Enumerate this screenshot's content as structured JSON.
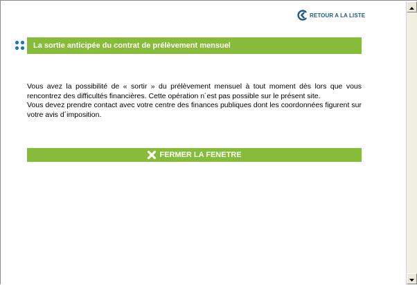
{
  "header": {
    "back_link_label": "RETOUR A LA LISTE"
  },
  "section": {
    "title": "La sortie anticipée du contrat de prélèvement mensuel"
  },
  "body": {
    "paragraph_1": "Vous avez la possibilité de « sortir » du prélèvement mensuel à tout moment dès lors que vous rencontrez des difficultés financières. Cette opération n´est pas possible sur le présent site.",
    "paragraph_2": "Vous devez prendre contact avec votre centre des finances publiques dont les coordonnées figurent sur votre avis d´imposition."
  },
  "actions": {
    "close_label": "FERMER LA FENETRE"
  },
  "colors": {
    "accent_green": "#86bc3a",
    "link_blue": "#1e5c88",
    "bullet_blue": "#1a7ab6"
  },
  "icons": {
    "back": "chevron-left-circle-icon",
    "bullet": "four-dots-icon",
    "close": "close-x-icon",
    "scroll_up": "arrow-up-icon",
    "scroll_down": "arrow-down-icon"
  }
}
